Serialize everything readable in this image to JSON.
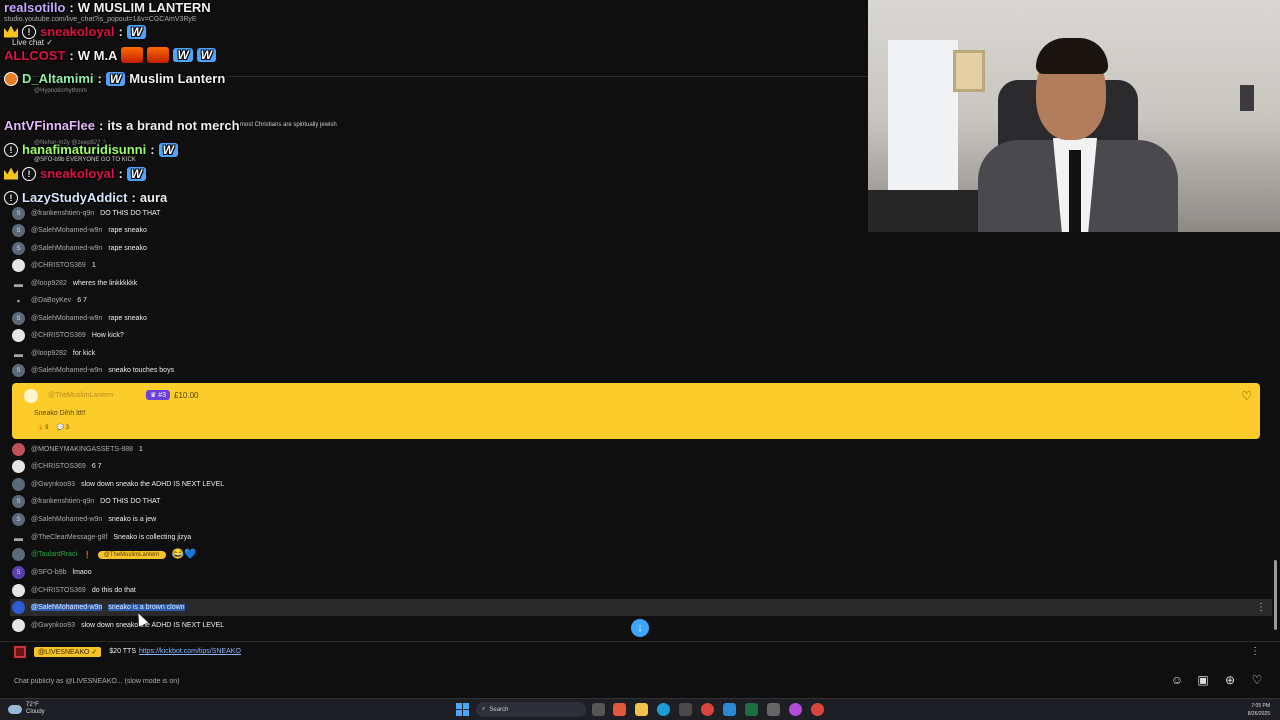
{
  "browser": {
    "url": "studio.youtube.com/live_chat?is_popout=1&v=CGCAmV3RyE",
    "live_chat_label": "Live chat ✓"
  },
  "overlay": [
    {
      "name": "realsotillo",
      "message": "W MUSLIM LANTERN"
    },
    {
      "name": "sneakoloyal",
      "message": "W"
    },
    {
      "name": "ALLCOST",
      "message": "W M.A"
    },
    {
      "name": "D_Altamimi",
      "message": "Muslim Lantern"
    },
    {
      "name": "AntVFinnaFlee",
      "message": "its a brand not merch"
    },
    {
      "name": "hanafimaturidisunni",
      "message": "W"
    },
    {
      "name": "sneakoloyal",
      "message": "W"
    },
    {
      "name": "LazyStudyAddict",
      "message": "aura"
    }
  ],
  "overlay_bg_text": {
    "line1": "@Hypnoticrhythmm",
    "line2": "@Nehar-m2y @zeep822 :)",
    "line3": "most Christians are spiritually jewish",
    "line4": "@SFO-b9b EVERYONE GO TO KICK"
  },
  "chat": [
    {
      "author": "@frankenshtien-q9n",
      "text": "DO THIS DO THAT",
      "av": "S"
    },
    {
      "author": "@SalehMohamed-w9n",
      "text": "rape sneako",
      "av": "S"
    },
    {
      "author": "@SalehMohamed-w9n",
      "text": "rape sneako",
      "av": "S"
    },
    {
      "author": "@CHRISTOS369",
      "text": "1",
      "av": ""
    },
    {
      "author": "@loop9282",
      "text": "wheres the linkkkkkk",
      "av": ""
    },
    {
      "author": "@DaBoyKev",
      "text": "6 7",
      "av": ""
    },
    {
      "author": "@SalehMohamed-w9n",
      "text": "rape sneako",
      "av": "S"
    },
    {
      "author": "@CHRISTOS369",
      "text": "How kick?",
      "av": ""
    },
    {
      "author": "@loop9282",
      "text": "for kick",
      "av": ""
    },
    {
      "author": "@SalehMohamed-w9n",
      "text": "sneako touches boys",
      "av": "S"
    }
  ],
  "superchat": {
    "author": "@TheMuslimLantern",
    "badge": "#3",
    "amount": "£10.00",
    "text": "Sneako Dihh Itt!!",
    "likes": "9",
    "replies": "3"
  },
  "chat2": [
    {
      "author": "@MONEYMAKINGASSETS-888",
      "text": "1"
    },
    {
      "author": "@CHRISTOS369",
      "text": "6 7"
    },
    {
      "author": "@Gwynkoo93",
      "text": "slow down sneako the ADHD IS NEXT LEVEL"
    },
    {
      "author": "@frankenshtien-q9n",
      "text": "DO THIS DO THAT"
    },
    {
      "author": "@SalehMohamed-w9n",
      "text": "sneako is a jew"
    },
    {
      "author": "@TheClearMessage-g8f",
      "text": "Sneako is collecting jizya"
    },
    {
      "author": "@TaulantRraci",
      "text": "😂💙",
      "mention": "@TheMuslimLantern"
    },
    {
      "author": "@SFO-b9b",
      "text": "lmaoo"
    },
    {
      "author": "@CHRISTOS369",
      "text": "do this do that"
    },
    {
      "author": "@SalehMohamed-w9n",
      "text": "sneako is a brown clown"
    },
    {
      "author": "@Gwynkoo93",
      "text": "slow down sneako the ADHD IS NEXT LEVEL"
    }
  ],
  "pinned": {
    "owner": "@LIVESNEAKO ✓",
    "text": "$20 TTS",
    "link": "https://kickbot.com/tips/SNEAKO"
  },
  "input": {
    "placeholder": "Chat publicly as @LIVESNEAKO... (slow mode is on)"
  },
  "taskbar": {
    "temp": "72°F",
    "weather": "Cloudy",
    "search": "Search",
    "time": "7:05 PM",
    "date": "8/26/2025"
  },
  "colors": {
    "superchat": "#fbcc2a",
    "accent": "#3ea6ff",
    "owner_badge": "#f7c325"
  }
}
